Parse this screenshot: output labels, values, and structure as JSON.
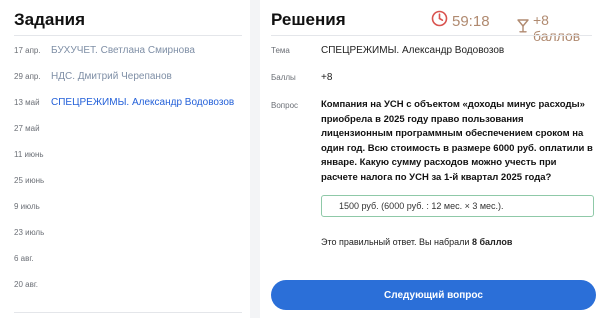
{
  "left": {
    "title": "Задания",
    "tasks": [
      {
        "date": "17 апр.",
        "title": "БУХУЧЕТ. Светлана Смирнова",
        "state": "done"
      },
      {
        "date": "29 апр.",
        "title": "НДС. Дмитрий Черепанов",
        "state": "done"
      },
      {
        "date": "13 май",
        "title": "СПЕЦРЕЖИМЫ. Александр Водовозов",
        "state": "active"
      },
      {
        "date": "27 май",
        "title": "",
        "state": "empty"
      },
      {
        "date": "11 июнь",
        "title": "",
        "state": "empty"
      },
      {
        "date": "25 июнь",
        "title": "",
        "state": "empty"
      },
      {
        "date": "9 июль",
        "title": "",
        "state": "empty"
      },
      {
        "date": "23 июль",
        "title": "",
        "state": "empty"
      },
      {
        "date": "6 авг.",
        "title": "",
        "state": "empty"
      },
      {
        "date": "20 авг.",
        "title": "",
        "state": "empty"
      }
    ]
  },
  "right": {
    "title": "Решения",
    "timer": "59:18",
    "points_badge": "+8 баллов",
    "topic_label": "Тема",
    "topic_value": "СПЕЦРЕЖИМЫ. Александр Водовозов",
    "score_label": "Баллы",
    "score_value": "+8",
    "question_label": "Вопрос",
    "question_text": "Компания на УСН с объектом «доходы минус расходы» приобрела в 2025 году право пользования лицензионным программным обеспечением сроком на один год. Всю стоимость в размере 6000 руб. оплатили в январе. Какую сумму расходов можно учесть при расчете налога по УСН за 1-й квартал 2025 года?",
    "answer": "1500 руб. (6000 руб. : 12 мес. × 3 мес.).",
    "result_prefix": "Это правильный ответ. Вы набрали",
    "result_points": "8 баллов",
    "next_button": "Следующий вопрос"
  },
  "colors": {
    "accent_blue": "#2b6fd8",
    "active_link": "#2461d9",
    "muted_link": "#7f8fa6",
    "timer_brown": "#b08a70",
    "timer_icon_red": "#d9534f",
    "answer_border_green": "#8fc9a8"
  },
  "icons": {
    "timer": "clock-icon",
    "points": "cup-icon"
  }
}
